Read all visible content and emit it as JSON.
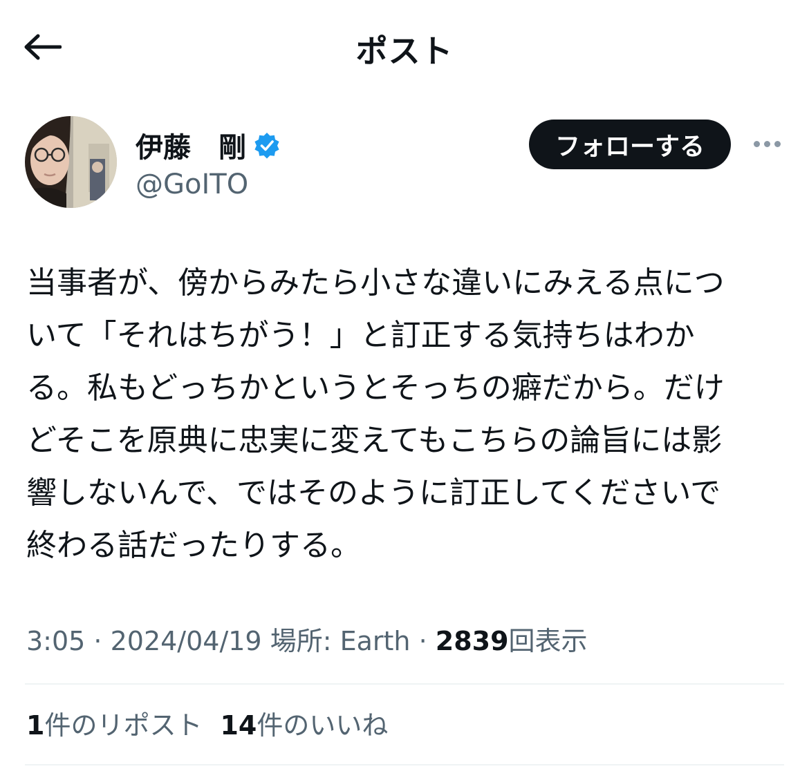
{
  "header": {
    "title": "ポスト",
    "back_icon": "arrow-left-icon"
  },
  "author": {
    "display_name": "伊藤　剛",
    "handle": "@GoITO",
    "verified": true,
    "verified_color": "#1d9bf0",
    "follow_label": "フォローする",
    "more_icon": "ellipsis-icon"
  },
  "tweet": {
    "lines": [
      "当事者が、傍からみたら小さな違いにみえる点につ",
      "いて「それはちがう！」と訂正する気持ちはわか",
      "る。私もどっちかというとそっちの癖だから。だけ",
      "どそこを原典に忠実に変えてもこちらの論旨には影",
      "響しないんで、ではそのように訂正してくださいで",
      "終わる話だったりする。"
    ]
  },
  "meta": {
    "time": "3:05",
    "sep1": " · ",
    "date": "2024/04/19",
    "location": "場所: Earth",
    "sep2": " · ",
    "views_count": "2839",
    "views_label": "回表示"
  },
  "stats": {
    "reposts_count": "1",
    "reposts_label": "件のリポスト",
    "likes_count": "14",
    "likes_label": "件のいいね"
  },
  "colors": {
    "text": "#0f1419",
    "secondary": "#536471",
    "divider": "#eff3f4",
    "button_bg": "#0f1419"
  }
}
